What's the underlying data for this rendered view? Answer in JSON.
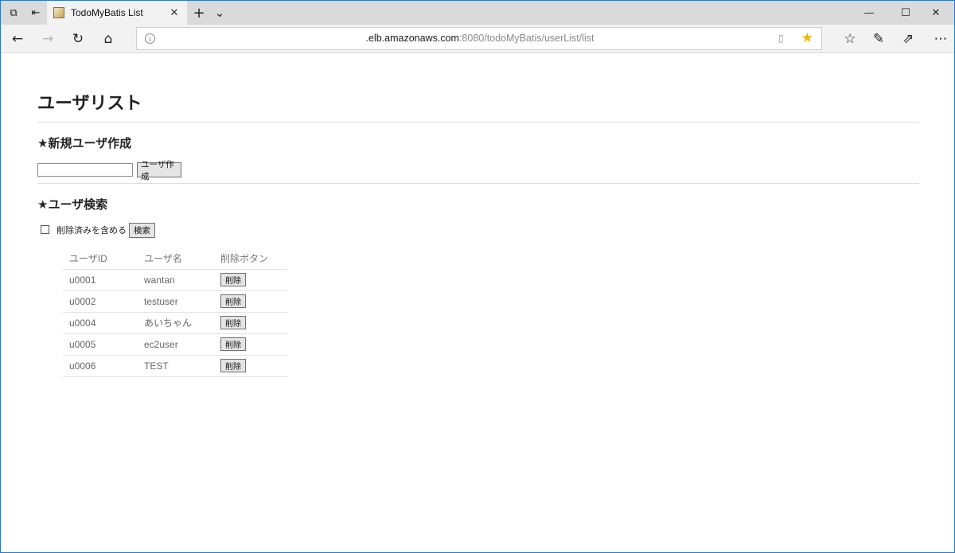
{
  "browser": {
    "tab_title": "TodoMyBatis List",
    "url_host": ".elb.amazonaws.com",
    "url_rest": ":8080/todoMyBatis/userList/list",
    "info_glyph": "i",
    "icons": {
      "tab_preview": "⧉",
      "set_aside": "⇤",
      "tab_close": "✕",
      "new_tab": "+",
      "tab_list": "⌄",
      "minimize": "—",
      "maximize": "☐",
      "close": "✕",
      "back": "←",
      "forward": "→",
      "refresh": "↻",
      "home": "⌂",
      "reading_view": "▯",
      "favorite": "★",
      "favorites_hub": "☆",
      "pen": "✎",
      "share": "⇗",
      "more": "⋯"
    }
  },
  "page": {
    "title": "ユーザリスト",
    "create_section": {
      "heading": "★新規ユーザ作成",
      "input_value": "",
      "button_label": "ユーザ作成"
    },
    "search_section": {
      "heading": "★ユーザ検索",
      "include_deleted_label": "削除済みを含める",
      "include_deleted_checked": false,
      "button_label": "検索"
    },
    "table": {
      "headers": [
        "ユーザID",
        "ユーザ名",
        "削除ボタン"
      ],
      "delete_label": "削除",
      "rows": [
        {
          "id": "u0001",
          "name": "wantan"
        },
        {
          "id": "u0002",
          "name": "testuser"
        },
        {
          "id": "u0004",
          "name": "あいちゃん"
        },
        {
          "id": "u0005",
          "name": "ec2user"
        },
        {
          "id": "u0006",
          "name": "TEST"
        }
      ]
    }
  },
  "colors": {
    "window_border": "#2b79c2",
    "titlebar": "#dadada",
    "favorite_star": "#f2b500"
  }
}
